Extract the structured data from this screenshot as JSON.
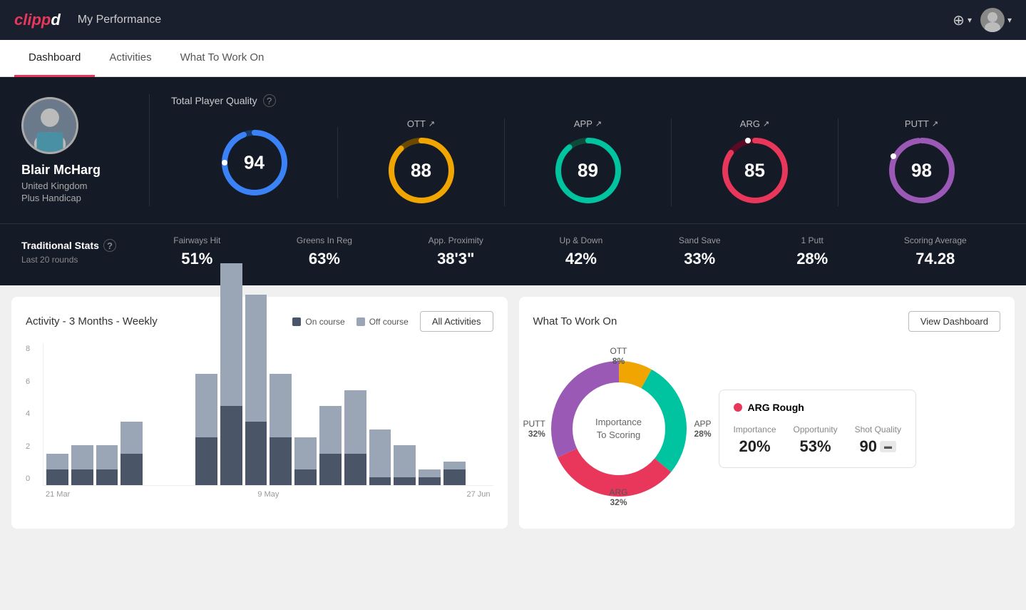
{
  "app": {
    "logo": "clippd",
    "title": "My Performance"
  },
  "header": {
    "add_icon": "+",
    "user_menu": "▾"
  },
  "nav": {
    "tabs": [
      {
        "label": "Dashboard",
        "active": true
      },
      {
        "label": "Activities",
        "active": false
      },
      {
        "label": "What To Work On",
        "active": false
      }
    ]
  },
  "player": {
    "name": "Blair McHarg",
    "country": "United Kingdom",
    "handicap": "Plus Handicap"
  },
  "quality": {
    "title": "Total Player Quality",
    "scores": [
      {
        "label": "",
        "value": "94",
        "color_track": "#2a5db0",
        "color_fill": "#3b82f6",
        "pct": 94
      },
      {
        "label": "OTT",
        "value": "88",
        "color_track": "#b8860b",
        "color_fill": "#f0a500",
        "pct": 88
      },
      {
        "label": "APP",
        "value": "89",
        "color_track": "#0d6b5e",
        "color_fill": "#00c4a0",
        "pct": 89
      },
      {
        "label": "ARG",
        "value": "85",
        "color_track": "#8b1a3a",
        "color_fill": "#e8375a",
        "pct": 85
      },
      {
        "label": "PUTT",
        "value": "98",
        "color_track": "#5a1a8a",
        "color_fill": "#9b59b6",
        "pct": 98
      }
    ]
  },
  "traditional_stats": {
    "title": "Traditional Stats",
    "subtitle": "Last 20 rounds",
    "items": [
      {
        "label": "Fairways Hit",
        "value": "51%"
      },
      {
        "label": "Greens In Reg",
        "value": "63%"
      },
      {
        "label": "App. Proximity",
        "value": "38'3\""
      },
      {
        "label": "Up & Down",
        "value": "42%"
      },
      {
        "label": "Sand Save",
        "value": "33%"
      },
      {
        "label": "1 Putt",
        "value": "28%"
      },
      {
        "label": "Scoring Average",
        "value": "74.28"
      }
    ]
  },
  "activity_chart": {
    "title": "Activity - 3 Months - Weekly",
    "legend": {
      "on_course": "On course",
      "off_course": "Off course"
    },
    "all_activities_btn": "All Activities",
    "y_labels": [
      "0",
      "2",
      "4",
      "6",
      "8"
    ],
    "x_labels": [
      "21 Mar",
      "9 May",
      "27 Jun"
    ],
    "bars": [
      {
        "on": 1,
        "off": 1
      },
      {
        "on": 1,
        "off": 1.5
      },
      {
        "on": 1,
        "off": 1.5
      },
      {
        "on": 2,
        "off": 2
      },
      {
        "on": 0,
        "off": 0
      },
      {
        "on": 0,
        "off": 0
      },
      {
        "on": 3,
        "off": 4
      },
      {
        "on": 5,
        "off": 9
      },
      {
        "on": 4,
        "off": 8
      },
      {
        "on": 3,
        "off": 4
      },
      {
        "on": 1,
        "off": 2
      },
      {
        "on": 2,
        "off": 3
      },
      {
        "on": 2,
        "off": 4
      },
      {
        "on": 0.5,
        "off": 3
      },
      {
        "on": 0.5,
        "off": 2
      },
      {
        "on": 0.5,
        "off": 0.5
      },
      {
        "on": 1,
        "off": 0.5
      },
      {
        "on": 0,
        "off": 0
      }
    ]
  },
  "what_to_work_on": {
    "title": "What To Work On",
    "view_dashboard_btn": "View Dashboard",
    "donut": {
      "center_text": "Importance\nTo Scoring",
      "segments": [
        {
          "label": "OTT",
          "pct": "8%",
          "color": "#f0a500",
          "value": 8
        },
        {
          "label": "APP",
          "pct": "28%",
          "color": "#00c4a0",
          "value": 28
        },
        {
          "label": "ARG",
          "pct": "32%",
          "color": "#e8375a",
          "value": 32
        },
        {
          "label": "PUTT",
          "pct": "32%",
          "color": "#9b59b6",
          "value": 32
        }
      ]
    },
    "arg_box": {
      "title": "ARG Rough",
      "metrics": [
        {
          "label": "Importance",
          "value": "20%"
        },
        {
          "label": "Opportunity",
          "value": "53%"
        },
        {
          "label": "Shot Quality",
          "value": "90"
        }
      ]
    }
  }
}
